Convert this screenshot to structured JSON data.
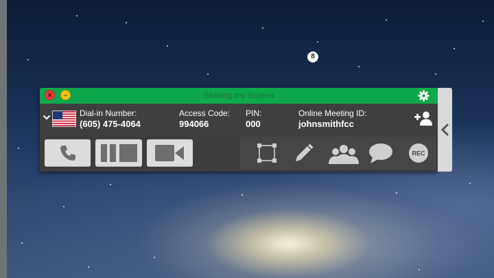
{
  "window": {
    "title": "Sharing my Screen",
    "accent_color": "#0da84b"
  },
  "info": {
    "country_flag": "us-flag-icon",
    "dial_in_label": "Dial-in Number:",
    "dial_in_value": "(605) 475-4064",
    "access_code_label": "Access Code:",
    "access_code_value": "994066",
    "pin_label": "PIN:",
    "pin_value": "000",
    "meeting_id_label": "Online Meeting ID:",
    "meeting_id_value": "johnsmithfcc"
  },
  "controls": {
    "participants_count": "8",
    "rec_label": "REC",
    "icons": [
      "phone-icon",
      "pause-icon",
      "stop-icon",
      "video-camera-icon",
      "select-region-icon",
      "pencil-icon",
      "participants-icon",
      "chat-icon",
      "record-icon"
    ]
  }
}
